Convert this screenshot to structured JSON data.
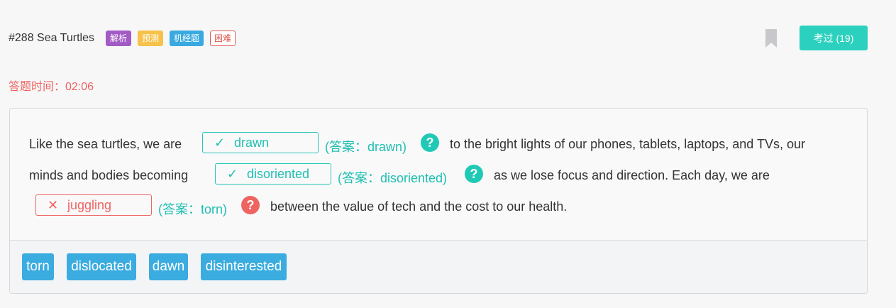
{
  "question": {
    "title": "#288 Sea Turtles",
    "tags": [
      {
        "label": "解析",
        "color": "#a25bc5"
      },
      {
        "label": "预测",
        "color": "#f7c24a"
      },
      {
        "label": "机经题",
        "color": "#39a9df"
      },
      {
        "label": "困难",
        "color": "#e2594f"
      }
    ],
    "passed_button": "考过 (19)",
    "timer": "答题时间：02:06"
  },
  "passage": {
    "line1_before": "Like the sea turtles, we are",
    "line1_after": "to the bright lights of our phones, tablets, laptops, and TVs, our",
    "line2_before": "minds and bodies becoming",
    "line2_after": "as we lose focus and direction. Each day, we are",
    "line3_after": "between the value of tech and the cost to our health.",
    "blanks": [
      {
        "mark": "✓",
        "value": "drawn",
        "answer": "(答案：drawn)",
        "status": "correct"
      },
      {
        "mark": "✓",
        "value": "disoriented",
        "answer": "(答案：disoriented)",
        "status": "correct"
      },
      {
        "mark": "✕",
        "value": "juggling",
        "answer": "(答案：torn)",
        "status": "wrong"
      }
    ],
    "help_icon": "?"
  },
  "options": [
    "torn",
    "dislocated",
    "dawn",
    "disinterested"
  ],
  "colors": {
    "accent_teal": "#2bd1be",
    "wrong_red": "#ee6461",
    "option_blue": "#3aace0"
  }
}
